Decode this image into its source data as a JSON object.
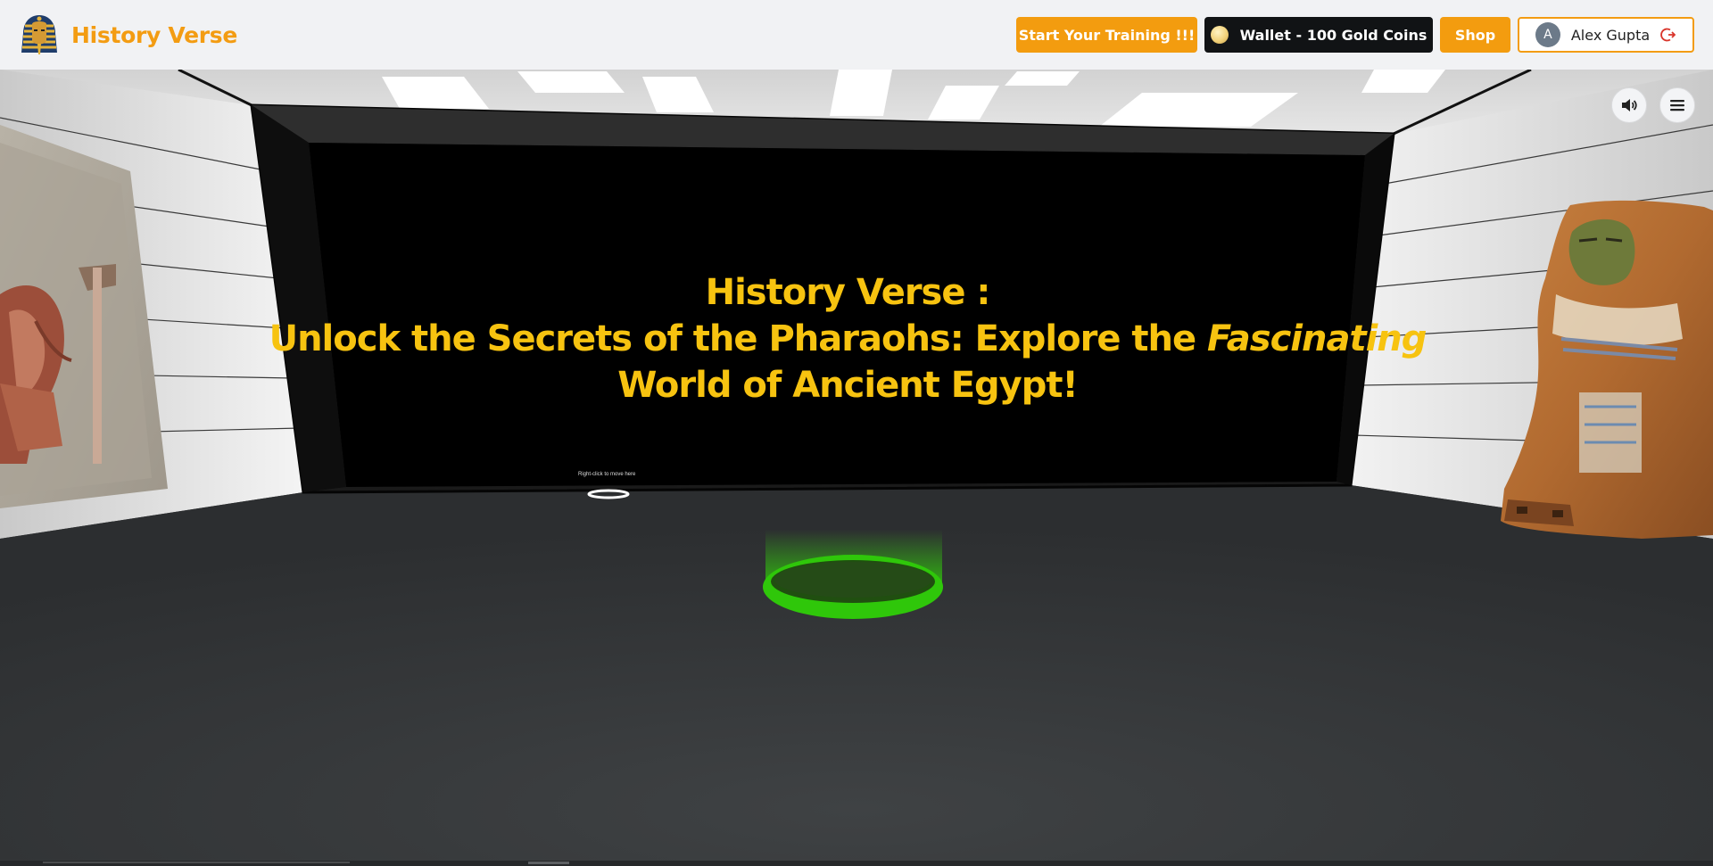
{
  "app": {
    "name": "History Verse"
  },
  "navbar": {
    "training_label": "Start Your Training !!!",
    "wallet_label": "Wallet - 100 Gold Coins",
    "shop_label": "Shop",
    "user": {
      "avatar_initial": "A",
      "name": "Alex Gupta"
    }
  },
  "scene": {
    "headline_line1": "History Verse :",
    "headline_line2_a": "Unlock the Secrets of the Pharaohs: Explore the ",
    "headline_line2_b": "Fascinating",
    "headline_line3": "World of Ancient Egypt!",
    "hint_text": "Right-click to move here",
    "controls": {
      "sound_icon": "speaker-icon",
      "menu_icon": "hamburger-menu-icon"
    }
  },
  "colors": {
    "accent": "#f39c12",
    "headline": "#f7c310",
    "teleport_ring": "#2fc70a",
    "wallet_bg": "#111315"
  }
}
